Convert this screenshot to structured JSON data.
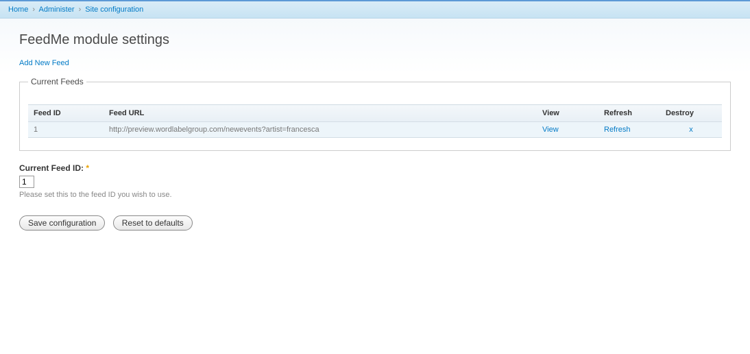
{
  "breadcrumb": {
    "items": [
      {
        "label": "Home"
      },
      {
        "label": "Administer"
      },
      {
        "label": "Site configuration"
      }
    ],
    "separator": "›"
  },
  "page": {
    "title": "FeedMe module settings",
    "add_link": "Add New Feed"
  },
  "feeds_fieldset": {
    "legend": "Current Feeds",
    "headers": {
      "feed_id": "Feed ID",
      "feed_url": "Feed URL",
      "view": "View",
      "refresh": "Refresh",
      "destroy": "Destroy"
    },
    "rows": [
      {
        "id": "1",
        "url": "http://preview.wordlabelgroup.com/newevents?artist=francesca",
        "view_label": "View",
        "refresh_label": "Refresh",
        "destroy_label": "x"
      }
    ]
  },
  "form": {
    "current_feed_id": {
      "label": "Current Feed ID:",
      "required_marker": "*",
      "value": "1",
      "description": "Please set this to the feed ID you wish to use."
    },
    "actions": {
      "save": "Save configuration",
      "reset": "Reset to defaults"
    }
  }
}
